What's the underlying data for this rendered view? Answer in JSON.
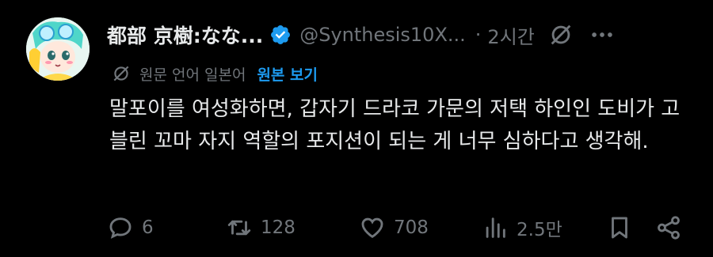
{
  "post": {
    "author_name": "都部 京樹:なな...",
    "handle": "@Synthesis10X...",
    "separator": "·",
    "time": "2시간",
    "translation": {
      "label": "원문 언어 일본어",
      "link": "원본 보기"
    },
    "text": "말포이를 여성화하면, 갑자기 드라코 가문의 저택 하인인 도비가 고블린 꼬마 자지 역할의 포지션이 되는 게 너무 심하다고 생각해."
  },
  "actions": {
    "replies": "6",
    "reposts": "128",
    "likes": "708",
    "views": "2.5만"
  },
  "colors": {
    "background": "#000000",
    "text": "#e7e9ea",
    "muted": "#71767b",
    "accent": "#1d9bf0"
  },
  "icons": [
    "verified-badge-icon",
    "grok-icon",
    "more-icon",
    "translate-icon",
    "reply-icon",
    "repost-icon",
    "like-icon",
    "views-icon",
    "bookmark-icon",
    "share-icon"
  ]
}
